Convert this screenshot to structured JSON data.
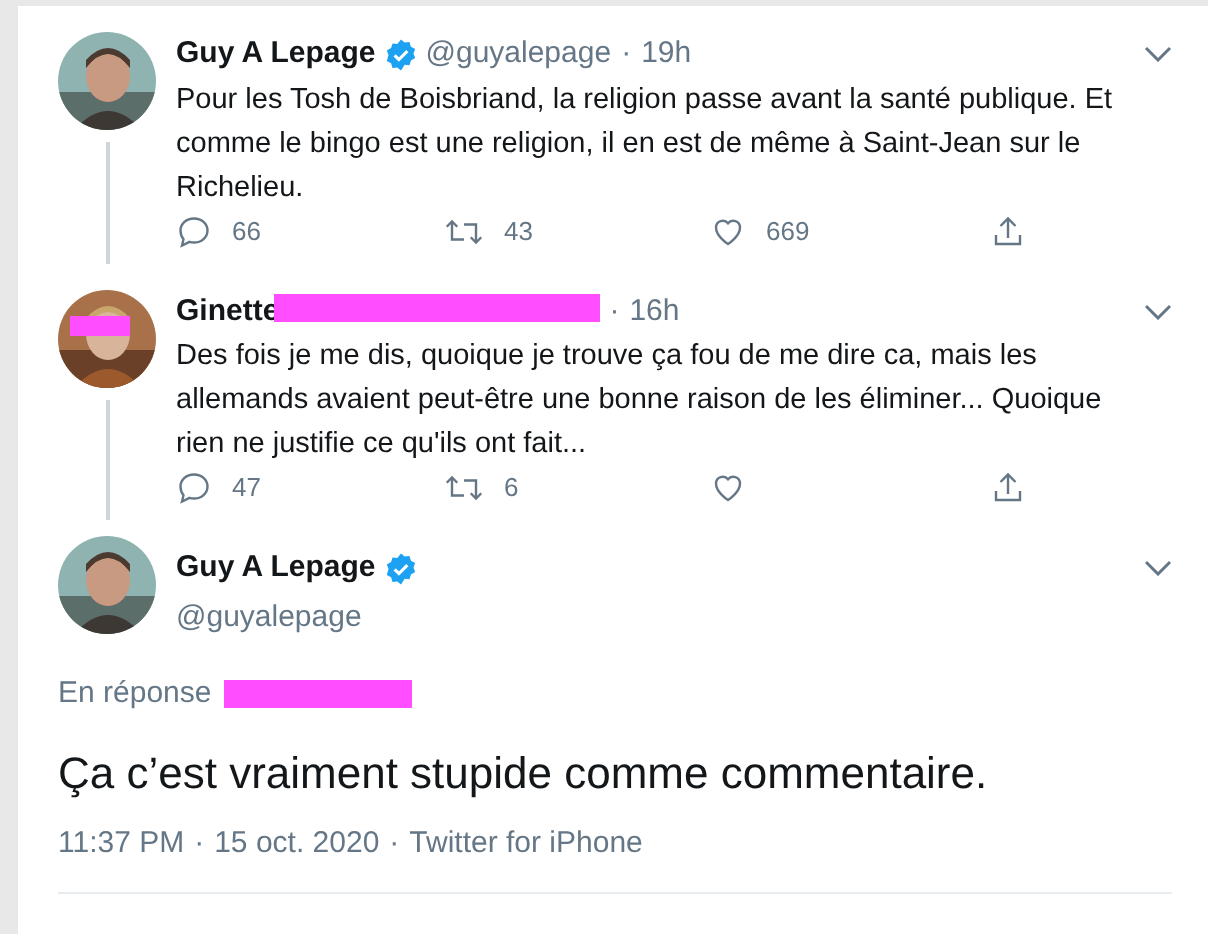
{
  "separator": "·",
  "tweets": [
    {
      "name": "Guy A Lepage",
      "verified": true,
      "handle": "@guyalepage",
      "time": "19h",
      "name_redacted": false,
      "avatar_redacted": false,
      "text": "Pour les Tosh de Boisbriand, la religion passe avant la santé publique. Et comme le bingo est une religion, il en est de même à Saint-Jean sur le Richelieu.",
      "replies": "66",
      "retweets": "43",
      "likes": "669"
    },
    {
      "name": "Ginette",
      "verified": false,
      "time": "16h",
      "name_redacted": true,
      "avatar_redacted": true,
      "text": "Des fois je me dis, quoique je trouve ça fou de me dire ca, mais les allemands avaient peut-être une bonne raison de les éliminer... Quoique rien ne justifie ce qu'ils ont fait...",
      "replies": "47",
      "retweets": "6"
    }
  ],
  "main": {
    "name": "Guy A Lepage",
    "verified": true,
    "handle": "@guyalepage",
    "reply_label": "En réponse",
    "reply_redacted": true,
    "text": "Ça c’est vraiment stupide comme commentaire.",
    "time": "11:37 PM",
    "date": "15 oct. 2020",
    "source": "Twitter for iPhone"
  }
}
